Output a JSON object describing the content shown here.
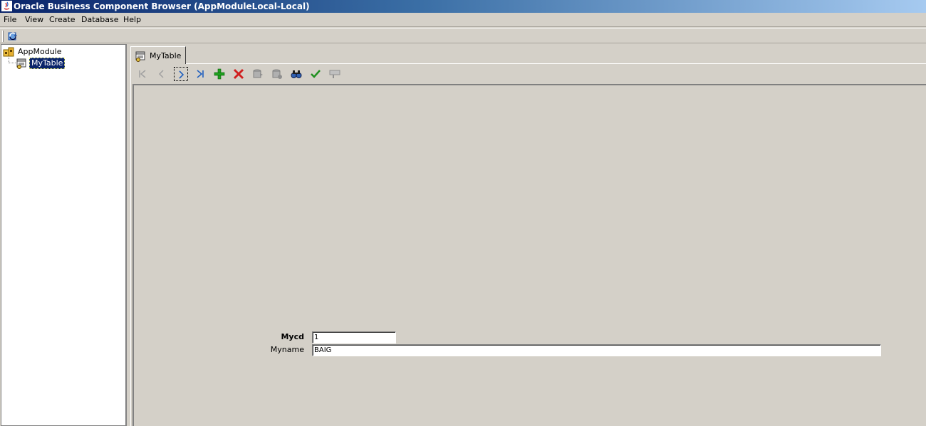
{
  "window": {
    "title": "Oracle Business Component Browser (AppModuleLocal-Local)"
  },
  "menu": {
    "file": "File",
    "view": "View",
    "create": "Create",
    "database": "Database",
    "help": "Help"
  },
  "tree": {
    "root": "AppModule",
    "child": "MyTable"
  },
  "tab": {
    "label": "MyTable"
  },
  "form": {
    "mycd_label": "Mycd",
    "mycd_value": "1",
    "myname_label": "Myname",
    "myname_value": "BAIG"
  }
}
